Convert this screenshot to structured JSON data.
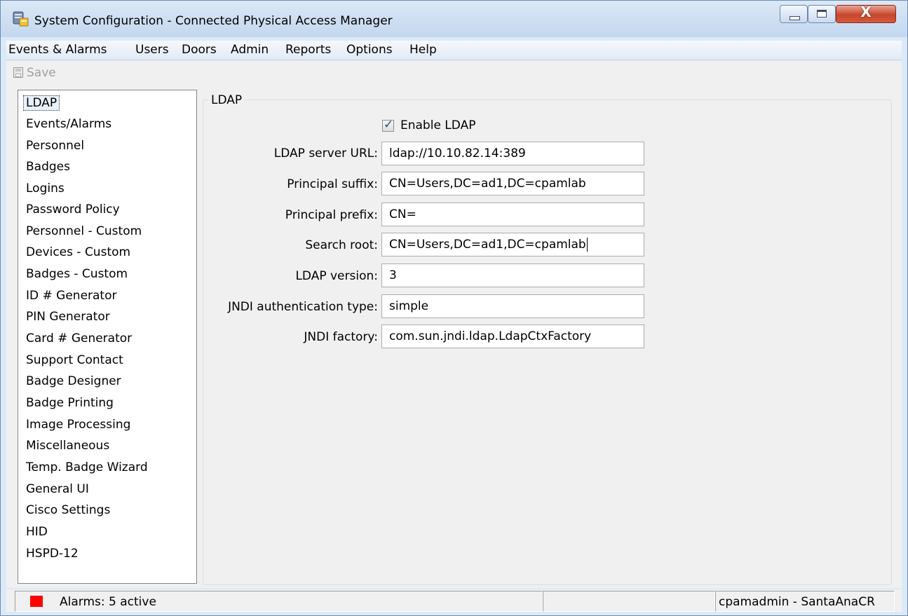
{
  "window": {
    "title": "System Configuration - Connected Physical Access Manager",
    "close_glyph": "X",
    "icon": "server-config-icon"
  },
  "menu": [
    "Events & Alarms",
    "Users",
    "Doors",
    "Admin",
    "Reports",
    "Options",
    "Help"
  ],
  "toolbar": {
    "save_label": "Save",
    "save_icon": "floppy-disk-icon"
  },
  "sidebar": {
    "selected": "LDAP",
    "items": [
      "LDAP",
      "Events/Alarms",
      "Personnel",
      "Badges",
      "Logins",
      "Password Policy",
      "Personnel - Custom",
      "Devices - Custom",
      "Badges - Custom",
      "ID # Generator",
      "PIN Generator",
      "Card # Generator",
      "Support Contact",
      "Badge Designer",
      "Badge Printing",
      "Image Processing",
      "Miscellaneous",
      "Temp. Badge Wizard",
      "General UI",
      "Cisco Settings",
      "HID",
      "HSPD-12"
    ]
  },
  "panel": {
    "title": "LDAP",
    "enable_label": "Enable LDAP",
    "enable_checked": true,
    "fields": [
      {
        "label": "LDAP server URL:",
        "value": "ldap://10.10.82.14:389"
      },
      {
        "label": "Principal suffix:",
        "value": "CN=Users,DC=ad1,DC=cpamlab"
      },
      {
        "label": "Principal prefix:",
        "value": "CN="
      },
      {
        "label": "Search root:",
        "value": "CN=Users,DC=ad1,DC=cpamlab"
      },
      {
        "label": "LDAP version:",
        "value": "3"
      },
      {
        "label": "JNDI authentication type:",
        "value": "simple"
      },
      {
        "label": "JNDI factory:",
        "value": "com.sun.jndi.ldap.LdapCtxFactory"
      }
    ]
  },
  "status": {
    "alarm_color": "#ff0000",
    "alarms": "Alarms: 5 active",
    "middle": "",
    "user": "cpamadmin - SantaAnaCR"
  }
}
